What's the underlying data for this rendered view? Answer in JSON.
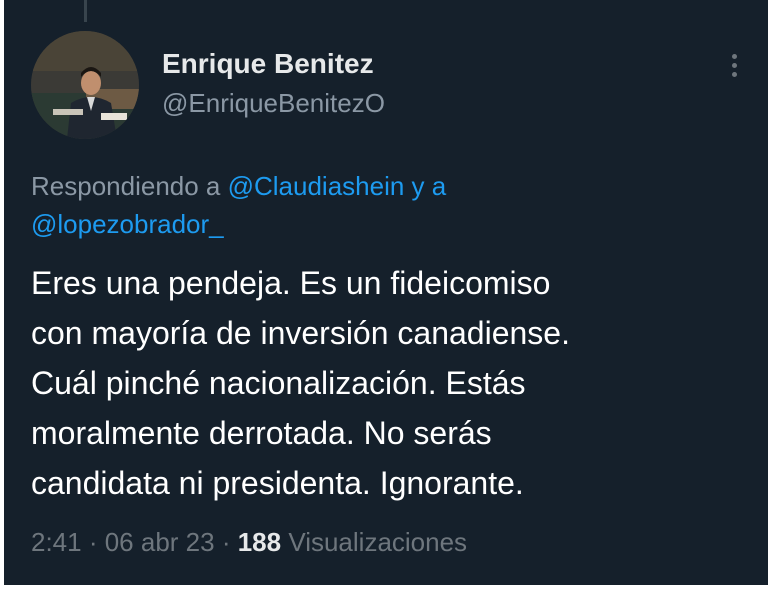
{
  "tweet": {
    "author": {
      "display_name": "Enrique Benitez",
      "handle": "@EnriqueBenitezO"
    },
    "replying_to": {
      "prefix": "Respondiendo a ",
      "mention_1": "@Claudiashein",
      "joiner": " y a",
      "mention_2": "@lopezobrador_"
    },
    "text": "Eres una pendeja. Es un fideicomiso\ncon mayoría de inversión canadiense.\nCuál pinché nacionalización. Estás\nmoralmente derrotada. No serás\ncandidata ni presidenta. Ignorante.",
    "meta": {
      "time": "2:41",
      "separator_1": " · ",
      "date": "06 abr 23",
      "separator_2": " · ",
      "views_count": "188",
      "views_label": " Visualizaciones"
    },
    "icons": {
      "more": "more-vertical-icon"
    },
    "colors": {
      "background": "#15202b",
      "text_primary": "#e7e9ea",
      "text_secondary": "#8b98a5",
      "link": "#1d9bf0"
    }
  }
}
